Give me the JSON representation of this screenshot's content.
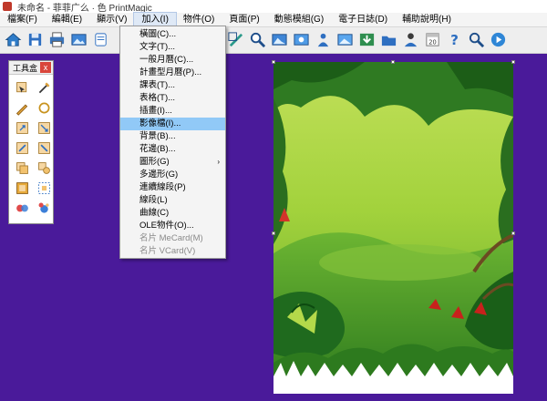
{
  "window": {
    "title": "未命名 - 菲菲广么 · 色 PrintMagic"
  },
  "menubar": [
    {
      "label": "檔案(F)",
      "active": false
    },
    {
      "label": "編輯(E)",
      "active": false
    },
    {
      "label": "顯示(V)",
      "active": false
    },
    {
      "label": "加入(I)",
      "active": true
    },
    {
      "label": "物件(O)",
      "active": false
    },
    {
      "label": "頁面(P)",
      "active": false
    },
    {
      "label": "動態模組(G)",
      "active": false
    },
    {
      "label": "電子日誌(D)",
      "active": false
    },
    {
      "label": "輔助說明(H)",
      "active": false
    }
  ],
  "toolbar": {
    "buttons": [
      "home-icon",
      "save-icon",
      "print-icon",
      "image-icon",
      "printer-icon",
      "frame-icon",
      "zoom-icon",
      "image-icon",
      "photo-icon",
      "person-icon",
      "image-icon",
      "download-icon",
      "folder-icon",
      "user-icon",
      "calendar-icon",
      "help-icon",
      "search-icon",
      "play-icon"
    ]
  },
  "toolbox": {
    "title": "工具盒",
    "close": "x",
    "tools": [
      "select-icon",
      "crop-icon",
      "pencil-icon",
      "ellipse-icon",
      "rotate-icon",
      "flip-icon",
      "align-icon",
      "group-icon",
      "copy-icon",
      "shape-icon",
      "layers-icon",
      "distribute-icon",
      "color-icon",
      "fill-icon"
    ]
  },
  "insert_menu": {
    "items": [
      {
        "label": "橫圖(C)...",
        "state": "normal"
      },
      {
        "label": "文字(T)...",
        "state": "normal"
      },
      {
        "label": "一般月曆(C)...",
        "state": "normal"
      },
      {
        "label": "計畫型月曆(P)...",
        "state": "normal"
      },
      {
        "label": "課表(T)...",
        "state": "normal"
      },
      {
        "label": "表格(T)...",
        "state": "normal"
      },
      {
        "label": "插畫(I)...",
        "state": "normal"
      },
      {
        "label": "影像檔(I)...",
        "state": "highlighted"
      },
      {
        "label": "背景(B)...",
        "state": "normal"
      },
      {
        "label": "花邊(B)...",
        "state": "normal"
      },
      {
        "label": "圖形(G)",
        "state": "normal",
        "submenu": "›"
      },
      {
        "label": "多邊形(G)",
        "state": "normal"
      },
      {
        "label": "連續線段(P)",
        "state": "normal"
      },
      {
        "label": "線段(L)",
        "state": "normal"
      },
      {
        "label": "曲線(C)",
        "state": "normal"
      },
      {
        "label": "OLE物件(O)...",
        "state": "normal"
      },
      {
        "label": "名片 MeCard(M)",
        "state": "disabled"
      },
      {
        "label": "名片 VCard(V)",
        "state": "disabled"
      }
    ]
  },
  "colors": {
    "workspace": "#4a1a9a",
    "menu_highlight": "#91c9f7",
    "jungle_light": "#a7d64a",
    "jungle_dark": "#1f6a1e"
  }
}
